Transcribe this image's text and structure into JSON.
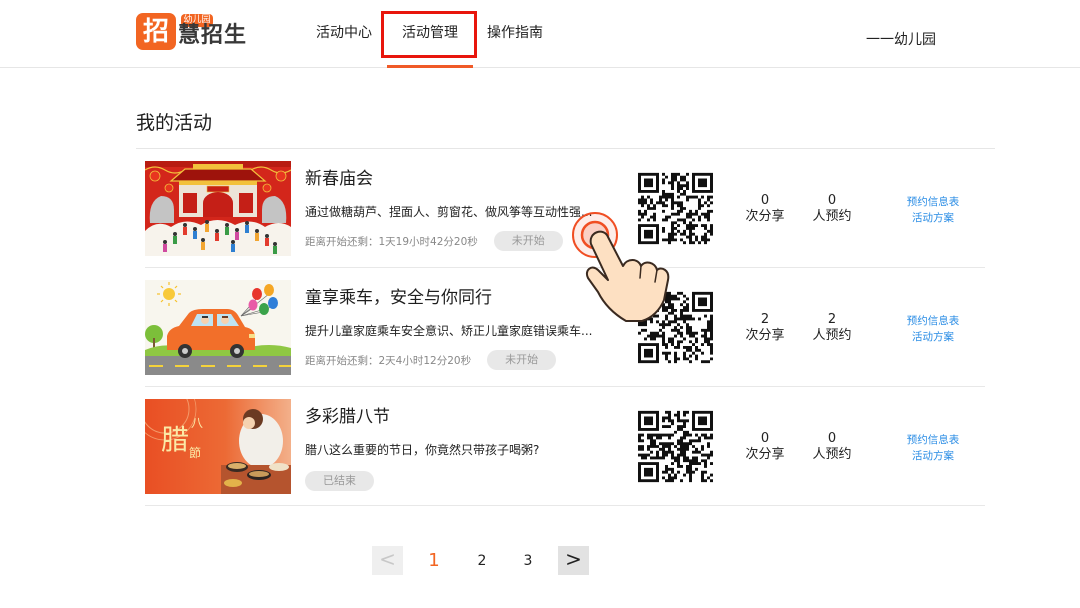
{
  "header": {
    "logo": {
      "glyph": "招",
      "badge": "幼儿园",
      "name": "慧招生"
    },
    "nav": [
      {
        "label": "活动中心",
        "active": false
      },
      {
        "label": "活动管理",
        "active": true
      },
      {
        "label": "操作指南",
        "active": false
      }
    ],
    "org_name": "一一幼儿园"
  },
  "main": {
    "title": "我的活动",
    "stat_labels": {
      "shares": "次分享",
      "bookings": "人预约"
    },
    "row_links": [
      "预约信息表",
      "活动方案"
    ],
    "activities": [
      {
        "title": "新春庙会",
        "desc": "通过做糖葫芦、捏面人、剪窗花、做风筝等互动性强...",
        "countdown": "距离开始还剩：1天19小时42分20秒",
        "status": "未开始",
        "shares": "0",
        "bookings": "0"
      },
      {
        "title": "童享乘车，安全与你同行",
        "desc": "提升儿童家庭乘车安全意识、矫正儿童家庭错误乘车...",
        "countdown": "距离开始还剩：2天4小时12分20秒",
        "status": "未开始",
        "shares": "2",
        "bookings": "2"
      },
      {
        "title": "多彩腊八节",
        "desc": "腊八这么重要的节日，你竟然只带孩子喝粥?",
        "status": "已结束",
        "shares": "0",
        "bookings": "0",
        "image_lettering": [
          "腊",
          "八",
          "節"
        ]
      }
    ]
  },
  "pagination": {
    "prev": "<",
    "prev_disabled": true,
    "pages": [
      {
        "label": "1",
        "current": true
      },
      {
        "label": "2",
        "current": false
      },
      {
        "label": "3",
        "current": false
      }
    ],
    "next": ">"
  },
  "icons": {
    "pointer": "hand-pointer-icon",
    "ripple": "click-ripple-icon",
    "qr": "qr-code"
  },
  "colors": {
    "accent": "#f26522",
    "highlight_box": "#e8160c",
    "link": "#2b8de5",
    "badge_bg": "#e8e8e8",
    "badge_text": "#999999"
  }
}
